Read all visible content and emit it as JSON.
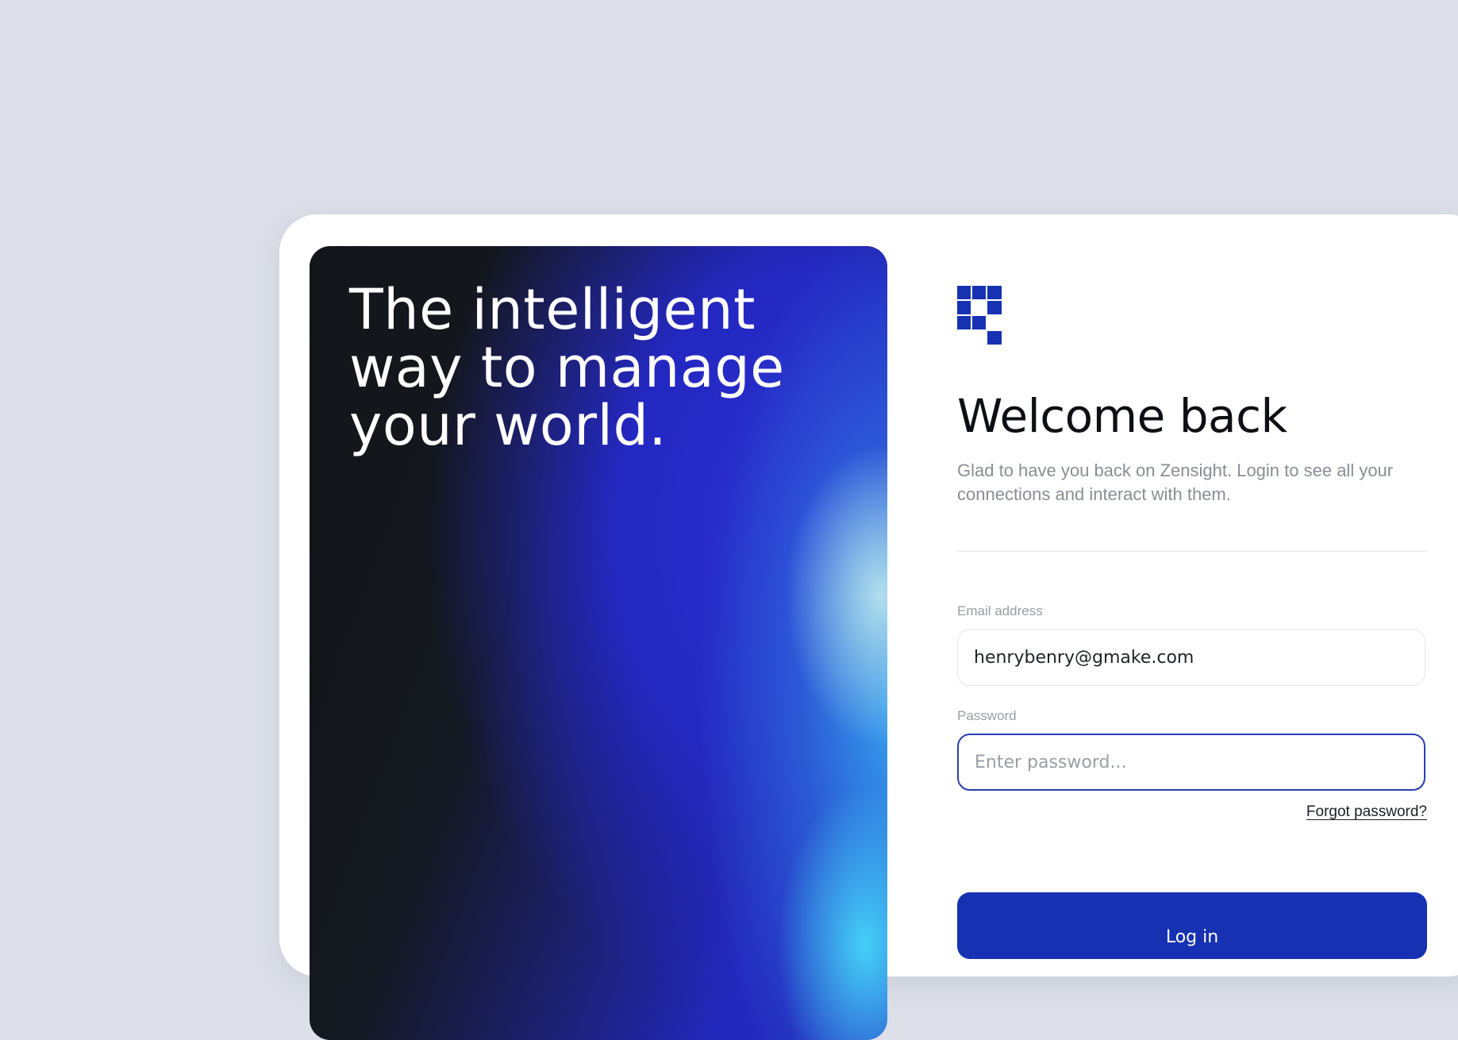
{
  "hero": {
    "title_line1": "The intelligent",
    "title_line2": "way to manage",
    "title_line3": "your world."
  },
  "brand": {
    "logo_icon": "pixel-grid-logo-icon",
    "accent_color": "#1632b2"
  },
  "login": {
    "heading": "Welcome back",
    "subtitle": "Glad to have you back on Zensight. Login to see all your connections and interact with them.",
    "email_label": "Email address",
    "email_value": "henrybenry@gmake.com",
    "password_label": "Password",
    "password_placeholder": "Enter password...",
    "forgot_label": "Forgot password?",
    "submit_label": "Log in"
  }
}
